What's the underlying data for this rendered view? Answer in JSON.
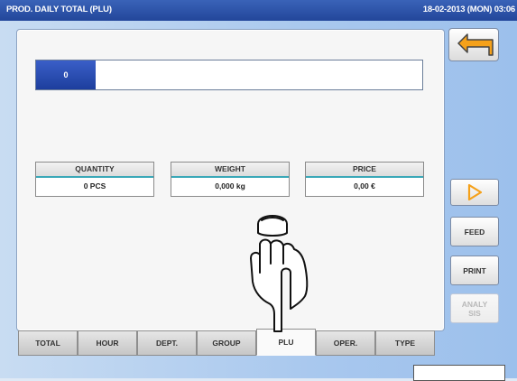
{
  "titlebar": {
    "title": "PROD. DAILY TOTAL (PLU)",
    "datetime": "18-02-2013 (MON) 03:06"
  },
  "progress": {
    "label": "0",
    "fraction": 0
  },
  "stats": {
    "quantity": {
      "label": "QUANTITY",
      "value": "0 PCS"
    },
    "weight": {
      "label": "WEIGHT",
      "value": "0,000 kg"
    },
    "price": {
      "label": "PRICE",
      "value": "0,00 €"
    }
  },
  "tabs": [
    {
      "label": "TOTAL"
    },
    {
      "label": "HOUR"
    },
    {
      "label": "DEPT."
    },
    {
      "label": "GROUP"
    },
    {
      "label": "PLU",
      "active": true
    },
    {
      "label": "OPER."
    },
    {
      "label": "TYPE"
    }
  ],
  "side_buttons": {
    "back_icon": "return-arrow-icon",
    "next_icon": "triangle-right-icon",
    "feed": "FEED",
    "print": "PRINT",
    "analysis_line1": "ANALY",
    "analysis_line2": "SIS"
  },
  "colors": {
    "titlebar": "#23469a",
    "accent_arrow": "#f5a11a",
    "progress_fill": "#1d3e9d",
    "tab_underline": "#3aa8b8"
  }
}
